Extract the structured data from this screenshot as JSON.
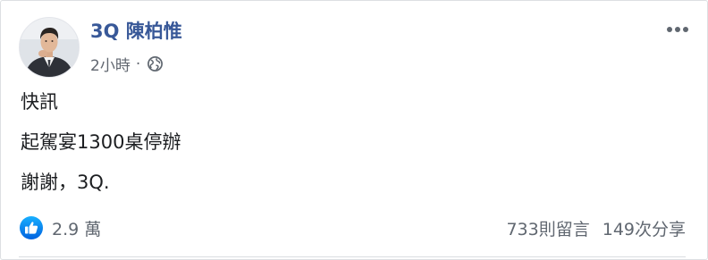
{
  "post": {
    "author": "3Q 陳柏惟",
    "timestamp": "2小時",
    "separator": "·",
    "privacy_icon": "globe-icon",
    "menu_icon": "more-options-icon",
    "lines": [
      "快訊",
      "起駕宴1300桌停辦",
      "謝謝，3Q."
    ]
  },
  "footer": {
    "reaction_icon": "like-icon",
    "reaction_count": "2.9 萬",
    "comments": "733則留言",
    "shares": "149次分享"
  },
  "colors": {
    "author_link": "#385898",
    "secondary_text": "#606770",
    "like_blue": "#1877f2"
  }
}
